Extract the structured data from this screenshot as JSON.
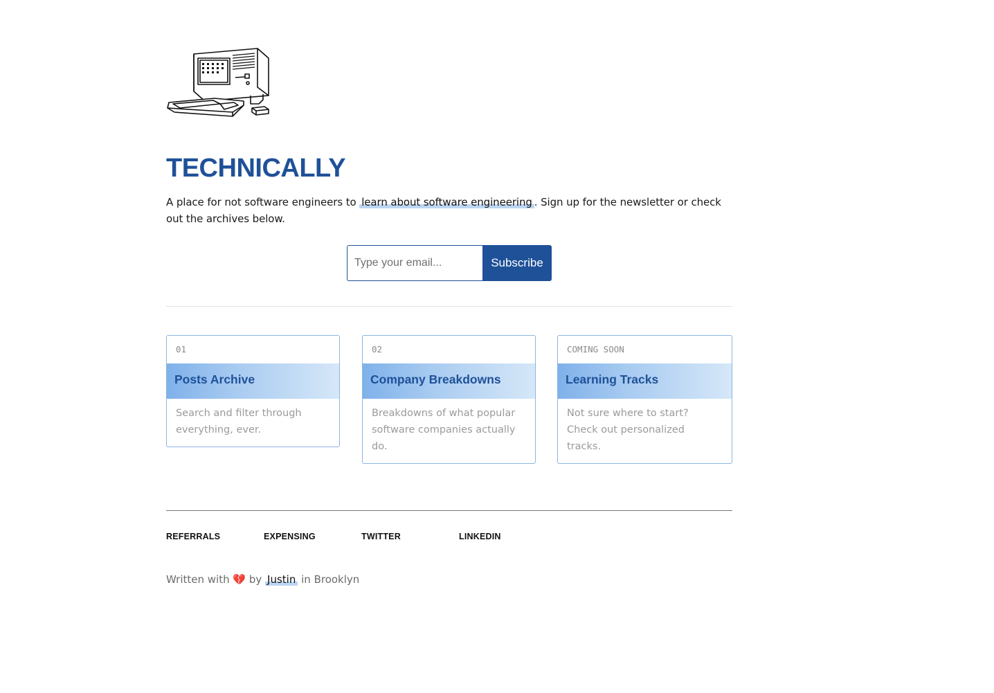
{
  "brand": {
    "logo_icon": "retro-computer-illustration",
    "title": "TECHNICALLY"
  },
  "intro": {
    "text_before": "A place for not software engineers to ",
    "link_text": "learn about software engineering",
    "text_after": ". Sign up for the newsletter or check out the archives below."
  },
  "newsletter": {
    "email_placeholder": "Type your email...",
    "email_value": "",
    "subscribe_label": "Subscribe"
  },
  "cards": [
    {
      "number": "01",
      "title": "Posts Archive",
      "description": "Search and filter through everything, ever."
    },
    {
      "number": "02",
      "title": "Company Breakdowns",
      "description": "Breakdowns of what popular software companies actually do."
    },
    {
      "number": "COMING SOON",
      "title": "Learning Tracks",
      "description": "Not sure where to start? Check out personalized tracks."
    }
  ],
  "footer": {
    "links": [
      "REFERRALS",
      "EXPENSING",
      "TWITTER",
      "LINKEDIN"
    ],
    "credit": {
      "prefix": "Written with",
      "heart_icon": "💔",
      "by": "by",
      "author": "Justin",
      "suffix": "in Brooklyn"
    }
  },
  "colors": {
    "brand_blue": "#1f5199",
    "highlight": "#bcd6f2",
    "card_border": "#8bb5e0"
  }
}
